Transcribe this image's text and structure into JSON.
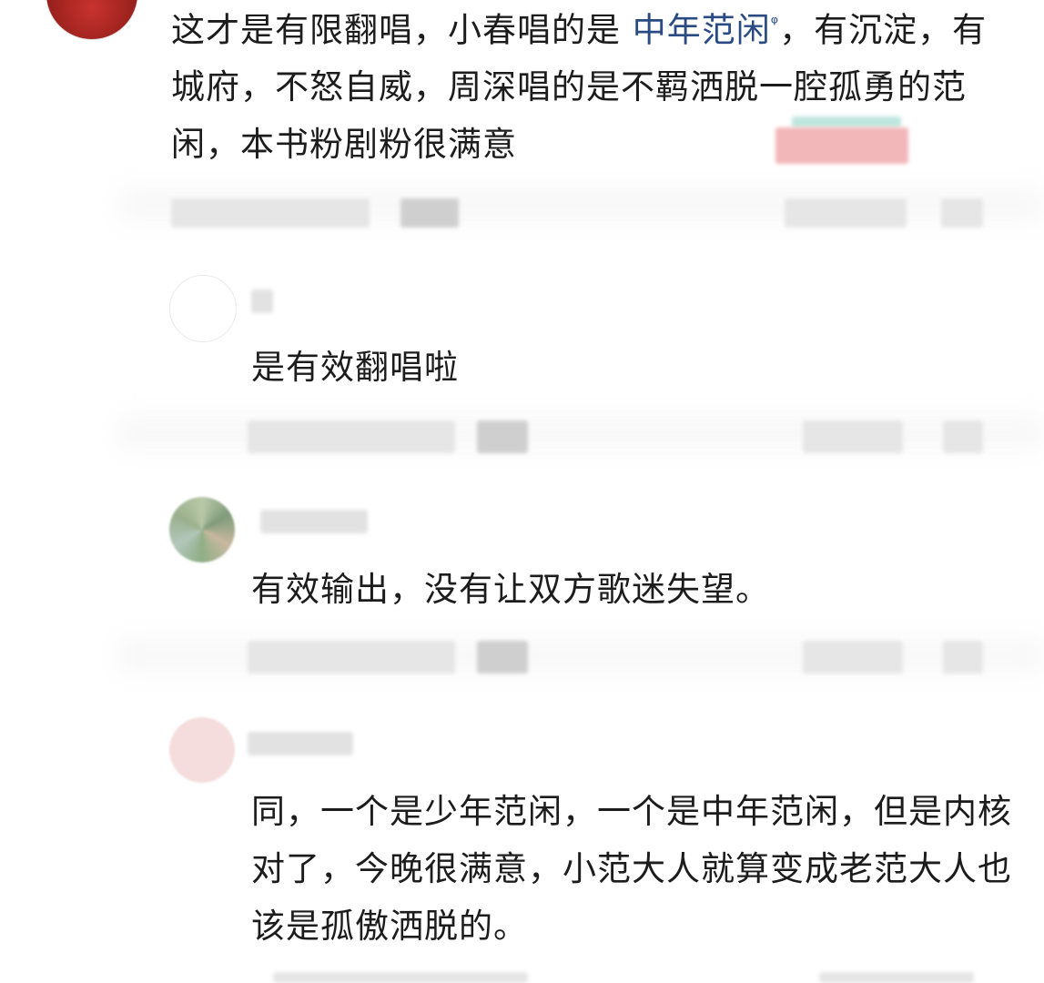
{
  "main_comment": {
    "text_before_link": "这才是有限翻唱，小春唱的是 ",
    "link_text": "中年范闲",
    "link_icon_glyph": "ᵠ",
    "text_after_link": "，有沉淀，有城府，不怒自威，周深唱的是不羁洒脱一腔孤勇的范闲，本书粉剧粉很满意"
  },
  "replies": [
    {
      "text": "是有效翻唱啦"
    },
    {
      "text": "有效输出，没有让双方歌迷失望。"
    },
    {
      "text": "同，一个是少年范闲，一个是中年范闲，但是内核对了，今晚很满意，小范大人就算变成老范大人也该是孤傲洒脱的。"
    }
  ],
  "colors": {
    "link": "#2a4a84",
    "text": "#1c1c1c"
  }
}
